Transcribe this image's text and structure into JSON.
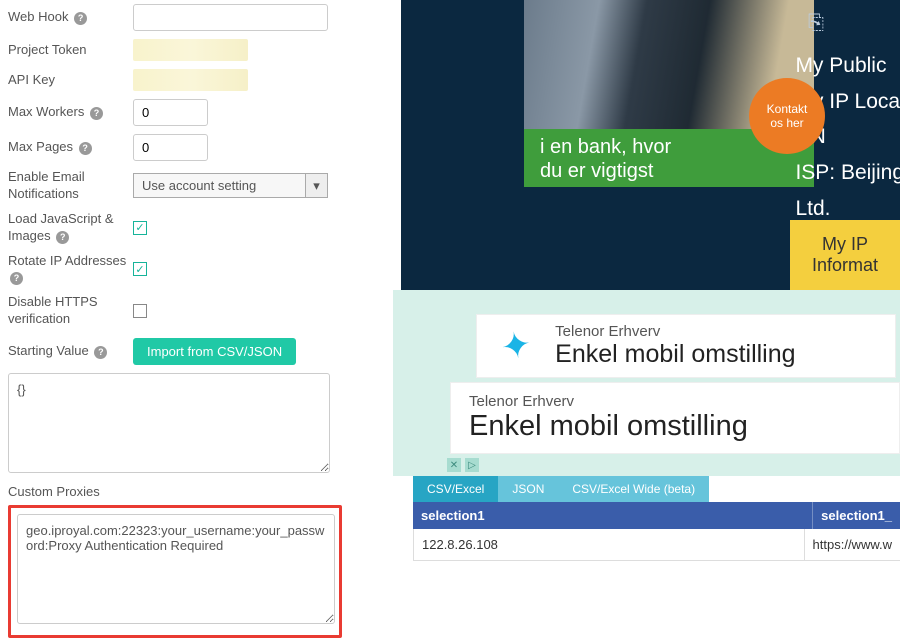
{
  "form": {
    "web_hook_label": "Web Hook",
    "web_hook_value": "",
    "project_token_label": "Project Token",
    "api_key_label": "API Key",
    "max_workers_label": "Max Workers",
    "max_workers_value": "0",
    "max_pages_label": "Max Pages",
    "max_pages_value": "0",
    "email_label": "Enable Email Notifications",
    "email_select": "Use account setting",
    "load_js_label": "Load JavaScript & Images",
    "rotate_ip_label": "Rotate IP Addresses",
    "disable_https_label": "Disable HTTPS verification",
    "starting_value_label": "Starting Value",
    "import_btn": "Import from CSV/JSON",
    "starting_value_text": "{}",
    "custom_proxies_label": "Custom Proxies",
    "custom_proxies_text": "geo.iproyal.com:22323:your_username:your_password:Proxy Authentication Required"
  },
  "hero": {
    "ad_line1": "i en bank, hvor",
    "ad_line2": "du er vigtigst",
    "badge_line1": "Kontakt",
    "badge_line2": "os her",
    "ip_public": "My Public",
    "ip_loc": "My IP Loca",
    "ip_cn": "CN",
    "ip_isp": "ISP: Beijing",
    "ip_ltd": "Ltd.",
    "yellow_line1": "My IP",
    "yellow_line2": "Informat"
  },
  "telenor": {
    "brand": "Telenor Erhverv",
    "headline": "Enkel mobil omstilling"
  },
  "results": {
    "tabs": {
      "csv": "CSV/Excel",
      "json": "JSON",
      "wide": "CSV/Excel Wide (beta)"
    },
    "headers": {
      "col1": "selection1",
      "col2": "selection1_"
    },
    "row": {
      "col1": "122.8.26.108",
      "col2": "https://www.w"
    }
  }
}
